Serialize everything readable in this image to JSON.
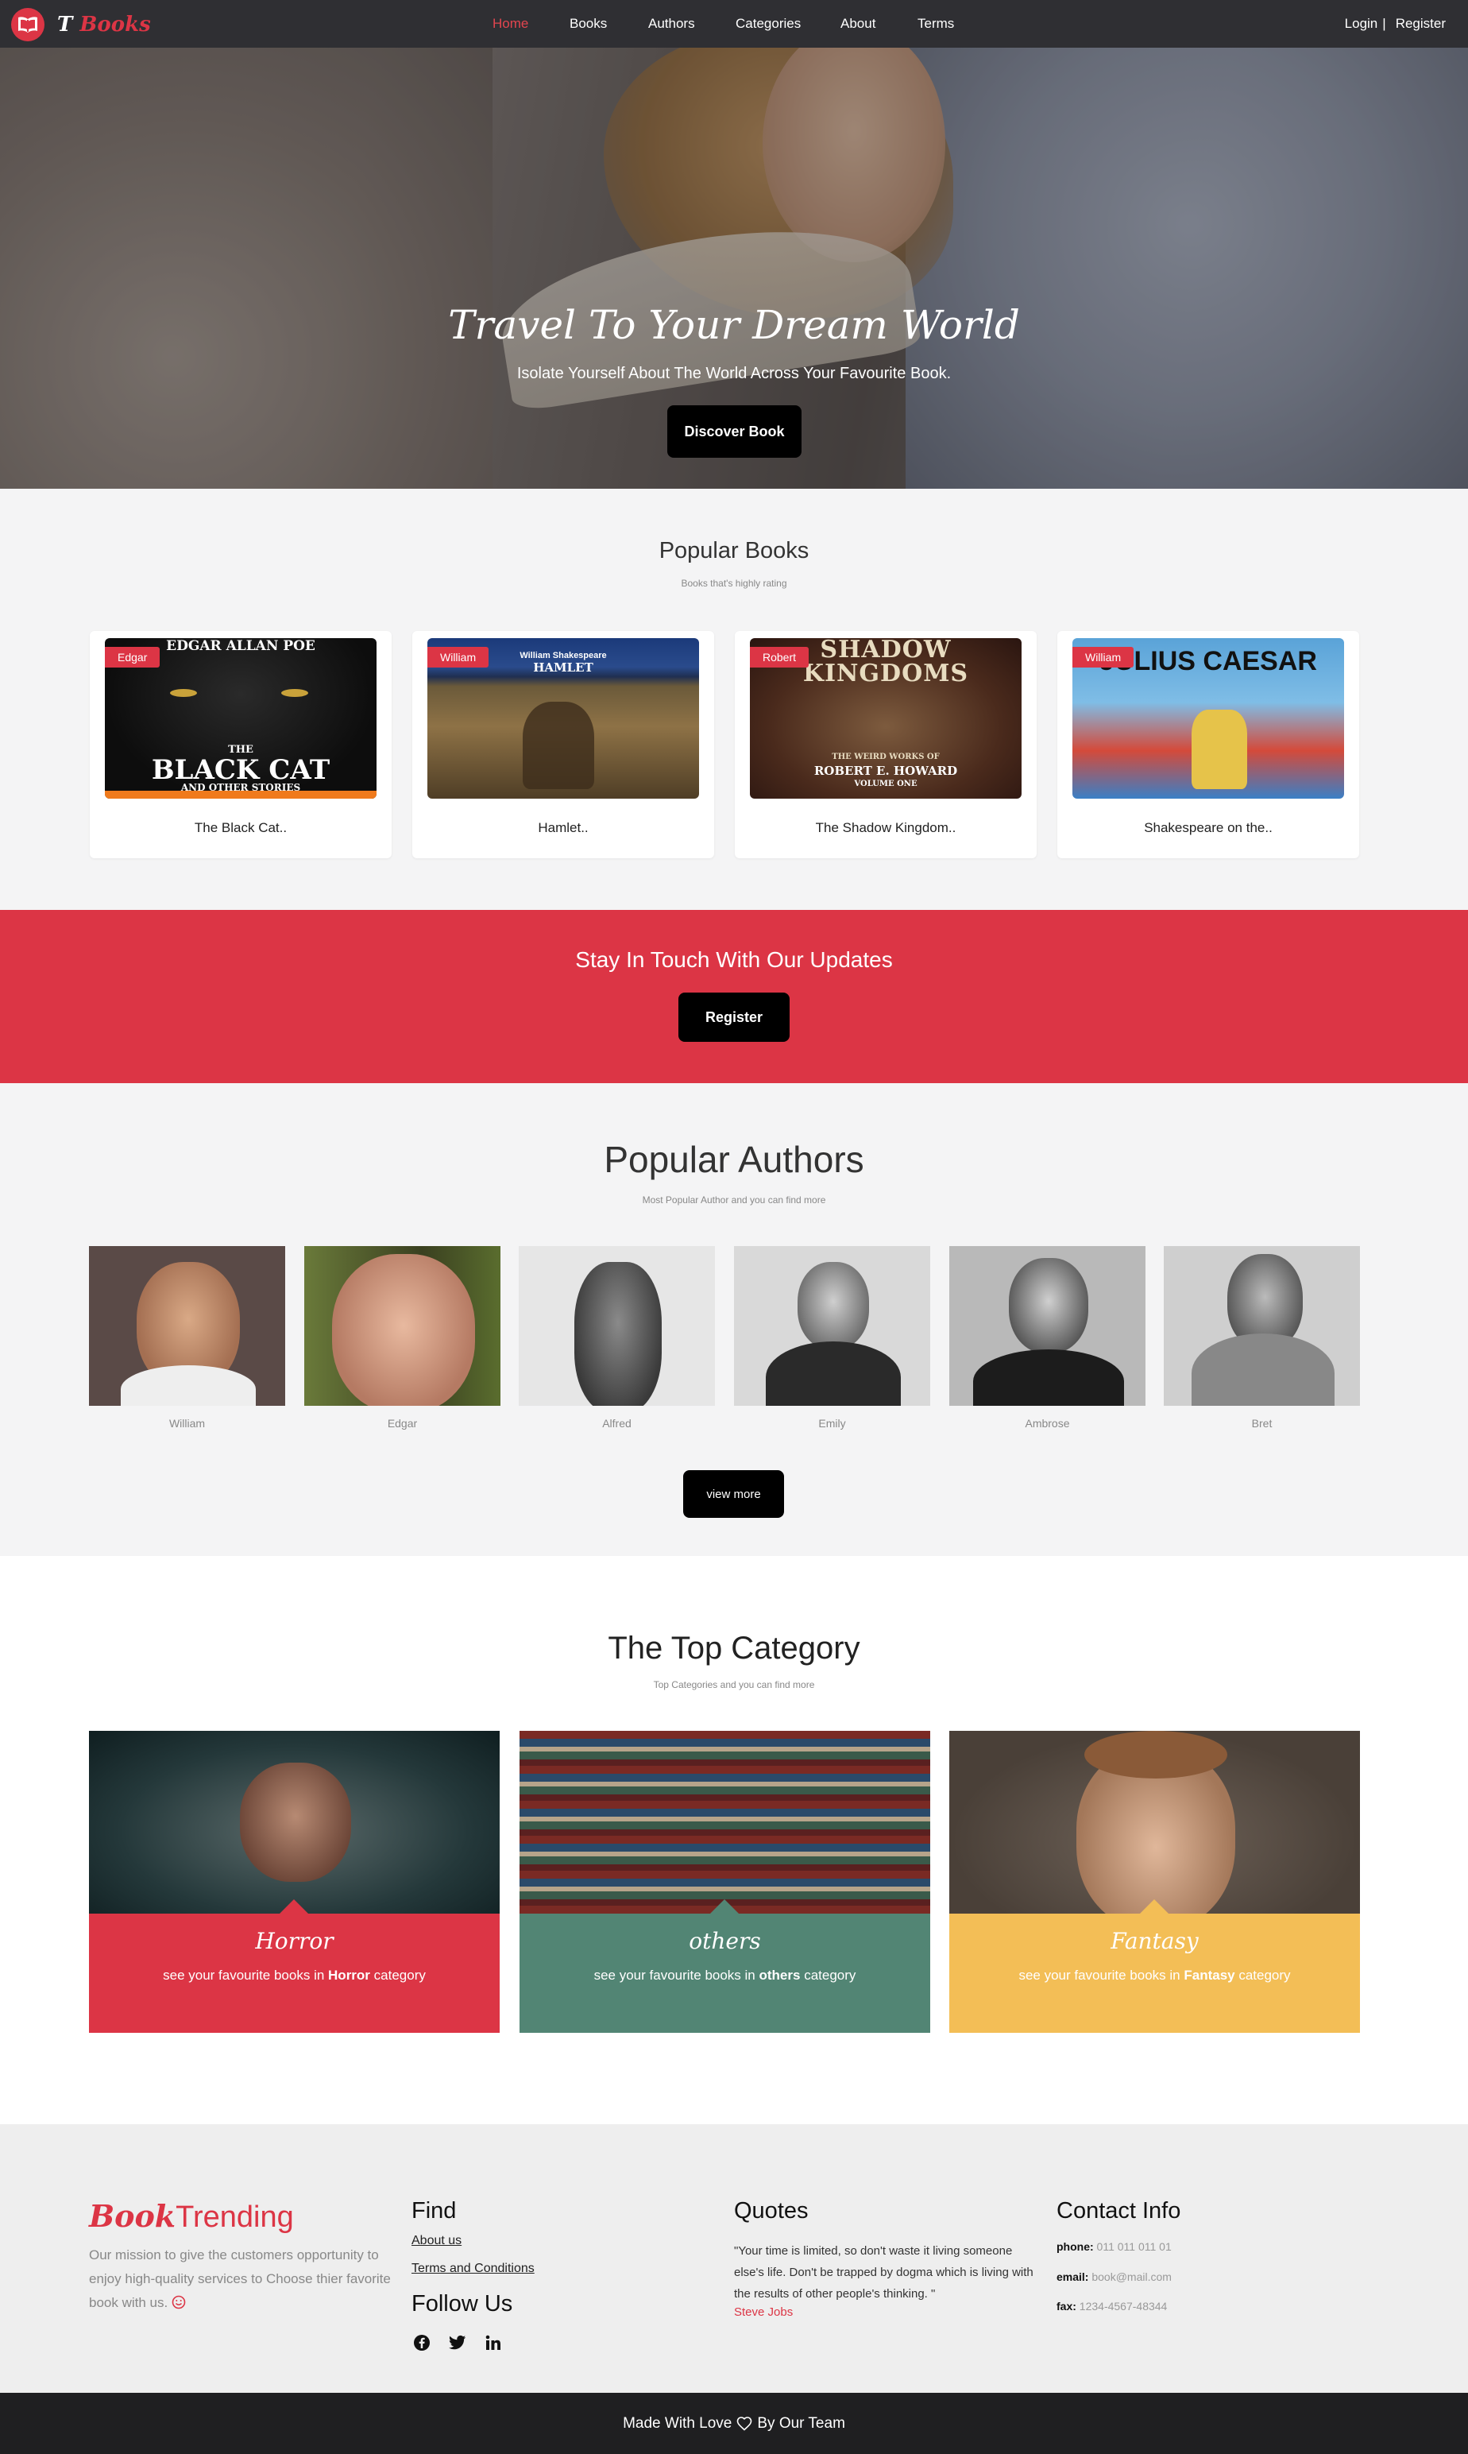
{
  "nav": {
    "logo_t": "T",
    "logo_books": "Books",
    "links": [
      "Home",
      "Books",
      "Authors",
      "Categories",
      "About",
      "Terms"
    ],
    "login": "Login",
    "separator": "|",
    "register": "Register",
    "active_color": "#e2454f"
  },
  "hero": {
    "title": "Travel To Your Dream World",
    "subtitle": "Isolate Yourself About The World Across Your Favourite Book.",
    "button": "Discover Book"
  },
  "popular_books": {
    "title": "Popular Books",
    "subtitle": "Books that's highly rating",
    "items": [
      {
        "badge": "Edgar",
        "title": "The Black Cat..",
        "cover_top": "EDGAR ALLAN POE",
        "cover_main": "BLACK CAT",
        "cover_the": "THE",
        "cover_sub": "AND OTHER STORIES"
      },
      {
        "badge": "William",
        "title": "Hamlet..",
        "cover_top": "William Shakespeare",
        "cover_main": "HAMLET"
      },
      {
        "badge": "Robert",
        "title": "The Shadow Kingdom..",
        "cover_main": "SHADOW KINGDOMS",
        "cover_sub": "ROBERT E. HOWARD",
        "cover_small": "THE WEIRD WORKS OF",
        "cover_vol": "VOLUME ONE"
      },
      {
        "badge": "William",
        "title": "Shakespeare on the..",
        "cover_main": "JULIUS CAESAR"
      }
    ]
  },
  "cta": {
    "title": "Stay In Touch With Our Updates",
    "button": "Register"
  },
  "authors": {
    "title": "Popular Authors",
    "subtitle": "Most Popular Author and you can find more",
    "names": [
      "William",
      "Edgar",
      "Alfred",
      "Emily",
      "Ambrose",
      "Bret"
    ],
    "button": "view more"
  },
  "categories": {
    "title": "The Top Category",
    "subtitle": "Top Categories and you can find more",
    "items": [
      {
        "name": "Horror",
        "pre": "see your favourite books in ",
        "bold": "Horror",
        "post": " category",
        "color": "#dc3545"
      },
      {
        "name": "others",
        "pre": "see your favourite books in ",
        "bold": "others",
        "post": " category",
        "color": "#528574"
      },
      {
        "name": "Fantasy",
        "pre": "see your favourite books in ",
        "bold": "Fantasy",
        "post": " category",
        "color": "#f3be56"
      }
    ]
  },
  "footer": {
    "brand_italic": "Book",
    "brand_rest": "Trending",
    "mission": "Our mission to give the customers opportunity to enjoy high-quality services to Choose thier favorite book with us.",
    "find_title": "Find",
    "find_links": [
      "About us",
      "Terms and Conditions"
    ],
    "follow_title": "Follow Us",
    "social_icons": [
      "facebook-icon",
      "twitter-icon",
      "linkedin-icon"
    ],
    "quotes_title": "Quotes",
    "quote": "\"Your time is limited, so don't waste it living someone else's life. Don't be trapped by dogma which is living with the results of other people's thinking. \"",
    "quote_author": "Steve Jobs",
    "contact_title": "Contact Info",
    "phone_label": "phone:",
    "phone": "011 011 011 01",
    "email_label": "email:",
    "email": "book@mail.com",
    "fax_label": "fax:",
    "fax": "1234-4567-48344"
  },
  "bottom_bar": {
    "pre": "Made With Love",
    "post": "By Our Team"
  },
  "colors": {
    "accent": "#dc3545",
    "nav_bg": "#2f2f33",
    "footer_bg": "#eeeeee",
    "bottom_bg": "#1f1f21"
  }
}
